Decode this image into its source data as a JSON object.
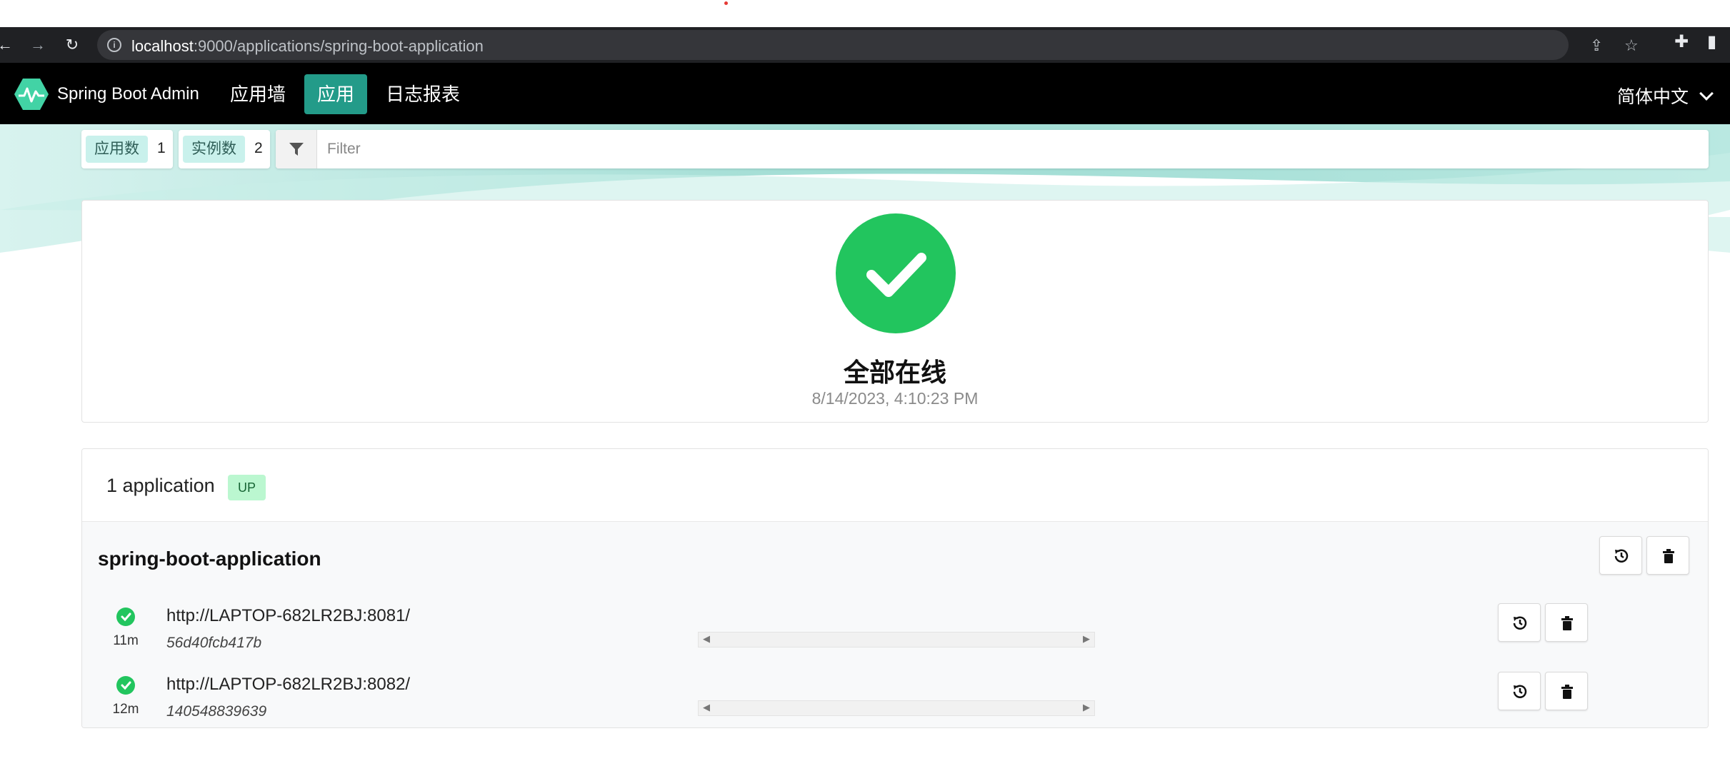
{
  "browser": {
    "url_host": "localhost",
    "url_rest": ":9000/applications/spring-boot-application"
  },
  "nav": {
    "brand": "Spring Boot Admin",
    "items": [
      {
        "label": "应用墙"
      },
      {
        "label": "应用"
      },
      {
        "label": "日志报表"
      }
    ],
    "active_item": "应用",
    "language": "简体中文"
  },
  "filter": {
    "apps_label": "应用数",
    "apps_count": "1",
    "instances_label": "实例数",
    "instances_count": "2",
    "placeholder": "Filter"
  },
  "status": {
    "title": "全部在线",
    "timestamp": "8/14/2023, 4:10:23 PM",
    "color": "#22c55e"
  },
  "applications": {
    "summary": "1 application",
    "badge": "UP",
    "app": {
      "name": "spring-boot-application",
      "instances": [
        {
          "url": "http://LAPTOP-682LR2BJ:8081/",
          "id": "56d40fcb417b",
          "age": "11m"
        },
        {
          "url": "http://LAPTOP-682LR2BJ:8082/",
          "id": "140548839639",
          "age": "12m"
        }
      ]
    }
  },
  "colors": {
    "accent": "#239b89",
    "up_badge_bg": "#bbf7d0"
  }
}
